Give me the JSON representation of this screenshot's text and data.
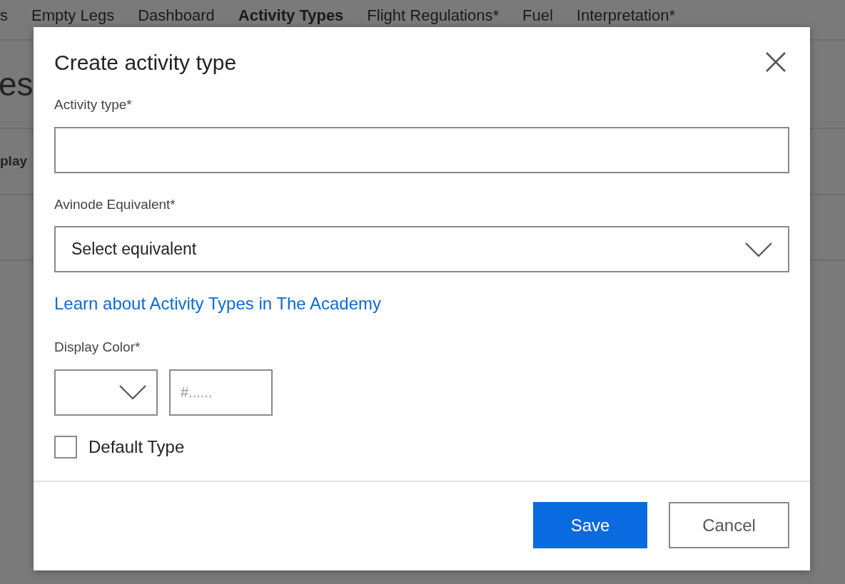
{
  "background": {
    "nav": [
      {
        "label": "s",
        "selected": false
      },
      {
        "label": "Empty Legs",
        "selected": false
      },
      {
        "label": "Dashboard",
        "selected": false
      },
      {
        "label": "Activity Types",
        "selected": true
      },
      {
        "label": "Flight Regulations*",
        "selected": false
      },
      {
        "label": "Fuel",
        "selected": false
      },
      {
        "label": "Interpretation*",
        "selected": false
      }
    ],
    "heading": "es",
    "column_header": "play"
  },
  "dialog": {
    "title": "Create activity type",
    "activity_type": {
      "label": "Activity type*"
    },
    "avinode_equivalent": {
      "label": "Avinode Equivalent*",
      "value": "Select equivalent"
    },
    "link": "Learn about Activity Types in The Academy",
    "display_color": {
      "label": "Display Color*",
      "hex_placeholder": "#......"
    },
    "default_type": {
      "label": "Default Type",
      "checked": false
    },
    "buttons": [
      {
        "label": "Save",
        "kind": "primary"
      },
      {
        "label": "Cancel",
        "kind": "secondary"
      }
    ]
  }
}
